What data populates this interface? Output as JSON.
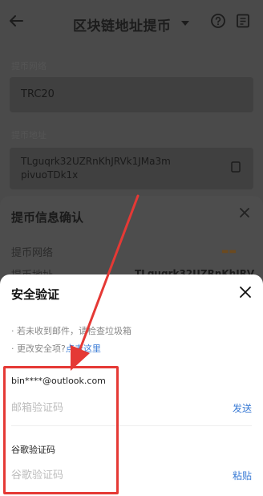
{
  "header": {
    "title": "区块链地址提币",
    "icons": [
      "back-icon",
      "chevron-down-icon",
      "help-icon",
      "record-icon"
    ]
  },
  "background": {
    "network_label": "提币网络",
    "network_value": "TRC20",
    "address_label": "提币地址",
    "address_line1": "TLguqrk32UZRnKhJRVk1JMa3m",
    "address_line2": "pivuoTDk1x"
  },
  "confirm_sheet": {
    "title": "提币信息确认",
    "row1_label": "提币网络",
    "row2_label": "提币地址",
    "row2_value": "TLguqrk32UZRnKhJRV"
  },
  "security_sheet": {
    "title": "安全验证",
    "hint1": "· 若未收到邮件，请检查垃圾箱",
    "hint2_prefix": "· 更改安全项?",
    "hint2_link": "点击这里",
    "email": "bin****@outlook.com",
    "email_code_placeholder": "邮箱验证码",
    "send_label": "发送",
    "google_label": "谷歌验证码",
    "google_code_placeholder": "谷歌验证码",
    "paste_label": "粘贴"
  },
  "colors": {
    "accent": "#3a7bd5",
    "annotation": "#e53935"
  }
}
